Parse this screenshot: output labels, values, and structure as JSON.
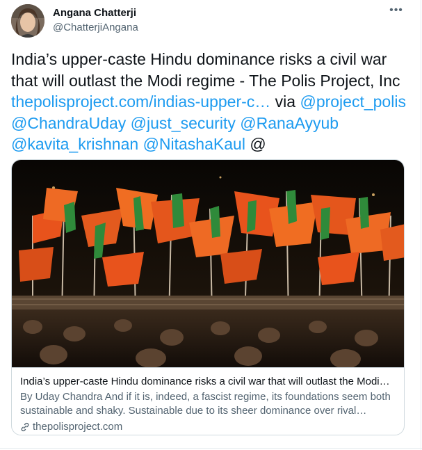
{
  "author": {
    "name": "Angana Chatterji",
    "handle": "@ChatterjiAngana"
  },
  "more_label": "•••",
  "tweet": {
    "text_line1": "India’s upper-caste Hindu dominance risks a civil war that will outlast the Modi regime - The Polis Project, Inc",
    "url": "thepolisproject.com/indias-upper-c…",
    "via": " via ",
    "mentions": [
      "@project_polis",
      "@ChandraUday",
      "@just_security",
      "@RanaAyyub",
      "@kavita_krishnan",
      "@NitashaKaul"
    ],
    "trailing": "@"
  },
  "card": {
    "title": "India’s upper-caste Hindu dominance risks a civil war that will outlast the Modi…",
    "description": "By Uday Chandra And if it is, indeed, a fascist regime, its foundations seem both sustainable and shaky. Sustainable due to its sheer dominance over rival…",
    "domain": "thepolisproject.com"
  },
  "colors": {
    "link": "#1d9bf0",
    "secondary_text": "#536471",
    "flag_saffron": "#e8531c",
    "flag_green": "#2f8a3a"
  }
}
